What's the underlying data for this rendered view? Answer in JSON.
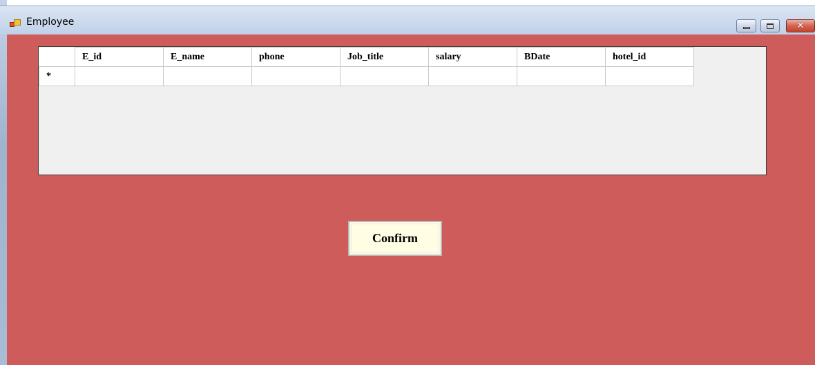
{
  "window": {
    "title": "Employee",
    "icon": "form-app-icon",
    "controls": {
      "minimize": "minimize-icon",
      "maximize": "maximize-icon",
      "close_glyph": "✕"
    }
  },
  "grid": {
    "columns": [
      "E_id",
      "E_name",
      "phone",
      "Job_title",
      "salary",
      "BDate",
      "hotel_id"
    ],
    "new_row_marker": "*",
    "rows": []
  },
  "actions": {
    "confirm_label": "Confirm"
  },
  "colors": {
    "client_background": "#cd5c5a",
    "grid_background": "#f0f0f0",
    "button_background": "#fffde3"
  }
}
